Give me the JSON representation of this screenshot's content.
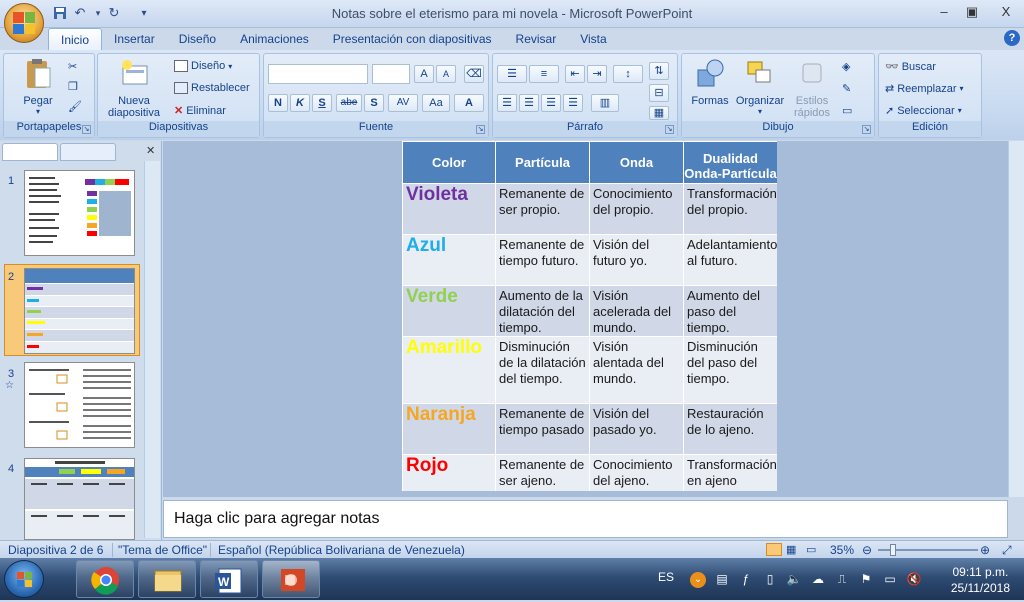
{
  "window": {
    "title": "Notas sobre el eterismo para mi novela - Microsoft PowerPoint",
    "min": "‒",
    "restore": "▣",
    "close": "X"
  },
  "ribbon": {
    "tabs": [
      "Inicio",
      "Insertar",
      "Diseño",
      "Animaciones",
      "Presentación con diapositivas",
      "Revisar",
      "Vista"
    ],
    "active_tab": "Inicio",
    "help": "?",
    "groups": {
      "portapapeles": {
        "label": "Portapapeles",
        "pegar": "Pegar"
      },
      "diapositivas": {
        "label": "Diapositivas",
        "nueva_1": "Nueva",
        "nueva_2": "diapositiva",
        "diseno": "Diseño",
        "restablecer": "Restablecer",
        "eliminar": "Eliminar"
      },
      "fuente": {
        "label": "Fuente",
        "font_name": "",
        "font_size": "",
        "bold": "N",
        "italic": "K",
        "underline": "S",
        "strike": "abe",
        "shadow": "S",
        "spacing": "AV",
        "case": "Aa",
        "color": "A",
        "grow": "A",
        "shrink": "A"
      },
      "parrafo": {
        "label": "Párrafo"
      },
      "dibujo": {
        "label": "Dibujo",
        "formas": "Formas",
        "organizar": "Organizar",
        "estilos_1": "Estilos",
        "estilos_2": "rápidos"
      },
      "edicion": {
        "label": "Edición",
        "buscar": "Buscar",
        "reemplazar": "Reemplazar",
        "seleccionar": "Seleccionar"
      }
    }
  },
  "slides_pane": {
    "slide_numbers": [
      "1",
      "2",
      "3",
      "4"
    ],
    "selected": 2
  },
  "slide": {
    "headers": [
      "Color",
      "Partícula",
      "Onda",
      "Dualidad Onda-Partícula"
    ],
    "rows": [
      {
        "color_name": "Violeta",
        "color_hex": "#7030a0",
        "particula": "Remanente de ser propio.",
        "onda": "Conocimiento del propio.",
        "dualidad": "Transformación del propio."
      },
      {
        "color_name": "Azul",
        "color_hex": "#1eaee8",
        "particula": "Remanente de tiempo futuro.",
        "onda": "Visión del futuro yo.",
        "dualidad": "Adelantamiento al futuro."
      },
      {
        "color_name": "Verde",
        "color_hex": "#92d050",
        "particula": "Aumento de la dilatación del tiempo.",
        "onda": "Visión acelerada del mundo.",
        "dualidad": "Aumento del paso del tiempo."
      },
      {
        "color_name": "Amarillo",
        "color_hex": "#ffff00",
        "particula": "Disminución de la dilatación del tiempo.",
        "onda": "Visión alentada del mundo.",
        "dualidad": "Disminución del paso del tiempo."
      },
      {
        "color_name": "Naranja",
        "color_hex": "#f5a623",
        "particula": "Remanente de tiempo pasado",
        "onda": "Visión del pasado yo.",
        "dualidad": "Restauración de lo ajeno."
      },
      {
        "color_name": "Rojo",
        "color_hex": "#ff0000",
        "particula": "Remanente de ser ajeno.",
        "onda": "Conocimiento del ajeno.",
        "dualidad": "Transformación en ajeno"
      }
    ]
  },
  "notes": {
    "placeholder": "Haga clic para agregar notas"
  },
  "status": {
    "slide_info": "Diapositiva 2 de 6",
    "theme": "\"Tema de Office\"",
    "language": "Español (República Bolivariana de Venezuela)",
    "zoom": "35%"
  },
  "taskbar": {
    "lang": "ES",
    "time": "09:11 p.m.",
    "date": "25/11/2018"
  },
  "colors": {
    "accent": "#15428b",
    "table_header": "#4f81bd",
    "selection": "#f8c978"
  }
}
